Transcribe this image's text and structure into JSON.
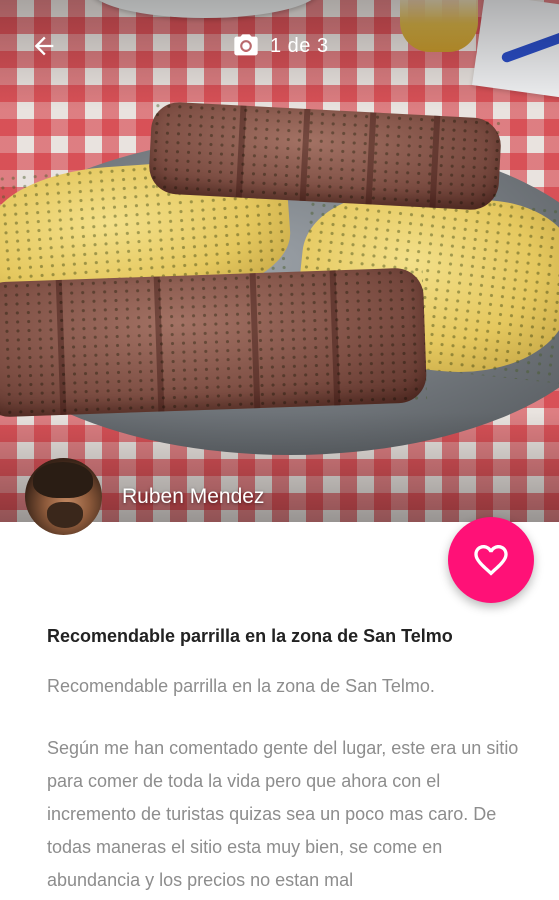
{
  "header": {
    "back_icon": "arrow-left-icon",
    "camera_icon": "camera-icon",
    "photo_counter": "1 de 3"
  },
  "author": {
    "name": "Ruben Mendez"
  },
  "favorite": {
    "icon": "heart-outline-icon",
    "color": "#ff1177"
  },
  "review": {
    "title": "Recomendable parrilla en la zona de San Telmo",
    "summary": "Recomendable parrilla en la zona de San Telmo.",
    "body": "Según me han comentado gente del lugar, este era un sitio para comer de toda la vida pero que ahora con el incremento de turistas quizas sea un poco mas caro. De todas maneras el sitio esta muy bien, se come en abundancia y los precios no estan mal"
  }
}
